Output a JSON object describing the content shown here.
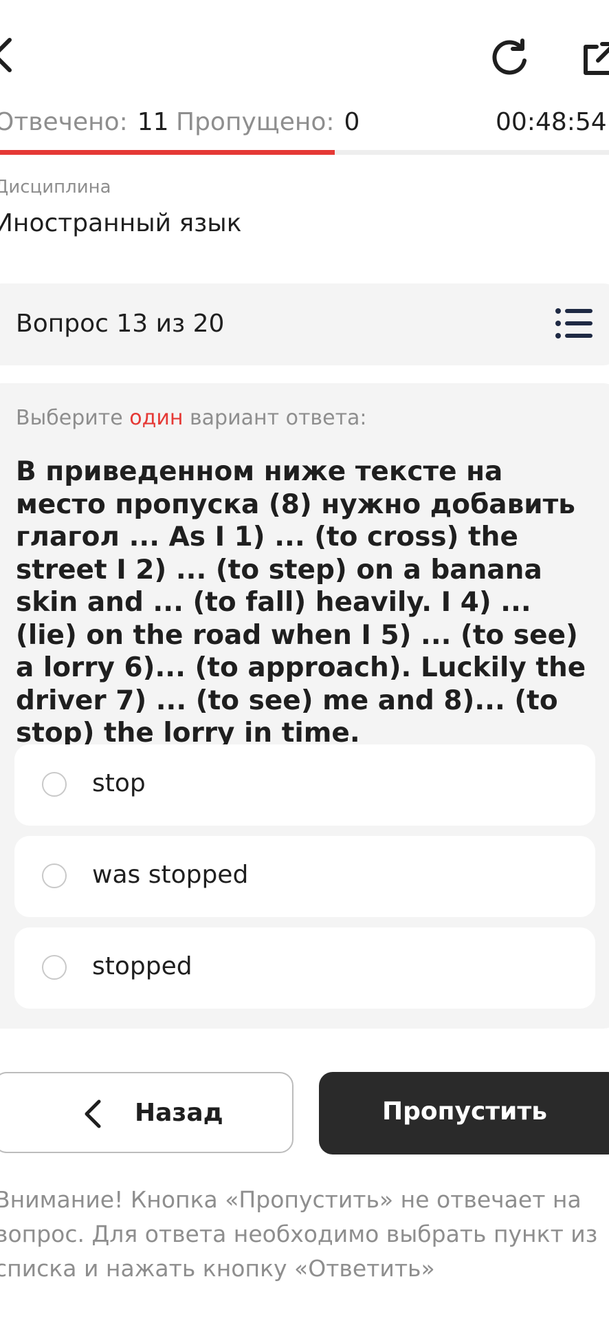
{
  "header": {
    "icons": {
      "back": "chevron-left-icon",
      "refresh": "refresh-icon",
      "share": "external-link-icon"
    }
  },
  "status": {
    "answered_label": "Отвечено:",
    "answered_value": "11",
    "skipped_label": "Пропущено:",
    "skipped_value": "0",
    "timer": "00:48:54",
    "progress_fraction": 0.55,
    "progress_color": "#e53935"
  },
  "discipline": {
    "label": "Дисциплина",
    "value": "Иностранный язык"
  },
  "question": {
    "number_text": "Вопрос 13 из 20",
    "list_icon": "list-icon",
    "instruction_prefix": "Выберите ",
    "instruction_accent": "один",
    "instruction_suffix": " вариант ответа:",
    "text": "В приведенном ниже тексте на место пропуска (8) нужно добавить глагол ... As I 1) ... (to cross) the street I 2) ... (to step) on a banana skin and ... (to fall) heavily. I 4) ... (lie) on the road when I 5) ... (to see) a lorry 6)... (to approach). Luckily the driver 7) ... (to see) me and 8)... (to stop) the lorry in time.",
    "options": [
      {
        "label": "stop",
        "selected": false
      },
      {
        "label": "was stopped",
        "selected": false
      },
      {
        "label": "stopped",
        "selected": false
      }
    ]
  },
  "actions": {
    "back_label": "Назад",
    "skip_label": "Пропустить"
  },
  "notice": "Внимание! Кнопка «Пропустить» не отвечает на вопрос. Для ответа необходимо выбрать пункт из списка и нажать кнопку «Ответить»",
  "colors": {
    "accent": "#e53935",
    "dark_button": "#2a2a2a",
    "card_bg": "#f4f4f4"
  }
}
